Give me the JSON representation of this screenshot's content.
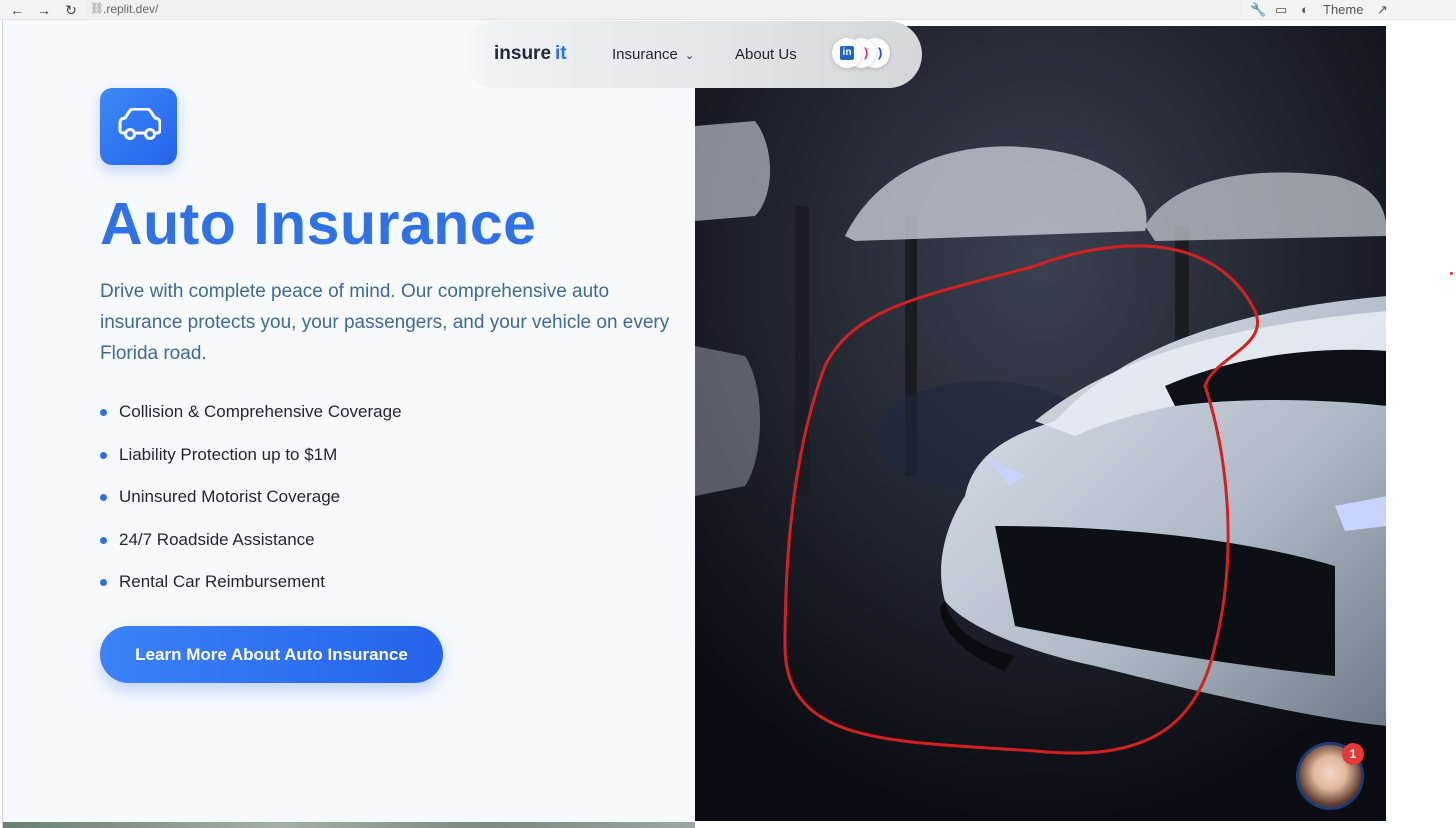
{
  "browser": {
    "back_icon": "←",
    "forward_icon": "→",
    "reload_icon": "↻",
    "url": ".replit.dev/",
    "theme_label": "Theme"
  },
  "nav": {
    "logo_main": "insure",
    "logo_accent": "it",
    "insurance_label": "Insurance",
    "about_label": "About Us",
    "social_icons": [
      "linkedin-icon",
      "instagram-icon",
      "facebook-icon"
    ]
  },
  "hero": {
    "icon": "car-icon",
    "title": "Auto Insurance",
    "description": "Drive with complete peace of mind. Our comprehensive auto insurance protects you, your passengers, and your vehicle on every Florida road.",
    "features": [
      "Collision & Comprehensive Coverage",
      "Liability Protection up to $1M",
      "Uninsured Motorist Coverage",
      "24/7 Roadside Assistance",
      "Rental Car Reimbursement"
    ],
    "cta_label": "Learn More About Auto Insurance"
  },
  "chat": {
    "notification_count": "1"
  },
  "colors": {
    "primary": "#2f72e6",
    "text_secondary": "#3f6a94",
    "annotation_red": "#d42020"
  }
}
